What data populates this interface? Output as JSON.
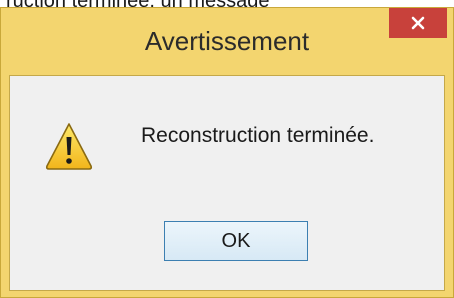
{
  "background": {
    "partial_text": "ruction terminée, un message"
  },
  "dialog": {
    "title": "Avertissement",
    "message": "Reconstruction terminée.",
    "ok_label": "OK",
    "close_glyph": "✕",
    "icon": "warning-icon"
  },
  "colors": {
    "frame": "#f3d56f",
    "close": "#c8413b",
    "client": "#f0f0f0",
    "ok_border": "#3c7fb1"
  }
}
